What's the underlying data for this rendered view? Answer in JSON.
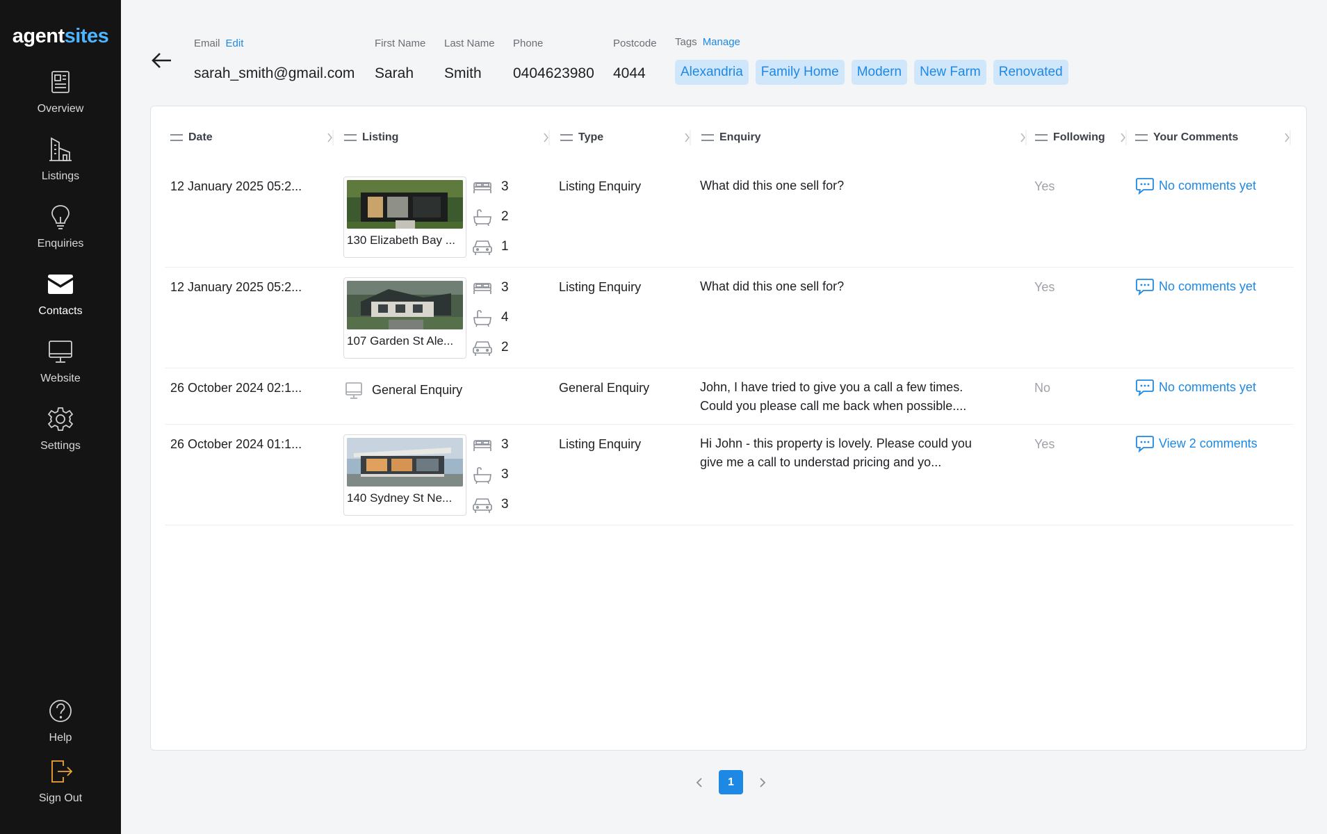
{
  "brand": {
    "part1": "agent",
    "part2": "sites"
  },
  "sidebar": {
    "items": [
      {
        "label": "Overview",
        "icon": "overview-icon"
      },
      {
        "label": "Listings",
        "icon": "listings-icon"
      },
      {
        "label": "Enquiries",
        "icon": "lightbulb-icon"
      },
      {
        "label": "Contacts",
        "icon": "envelope-icon",
        "active": true
      },
      {
        "label": "Website",
        "icon": "monitor-icon"
      },
      {
        "label": "Settings",
        "icon": "gear-icon"
      }
    ],
    "bottom": [
      {
        "label": "Help",
        "icon": "help-icon"
      },
      {
        "label": "Sign Out",
        "icon": "sign-out-icon"
      }
    ]
  },
  "contact": {
    "email_label": "Email",
    "email_edit": "Edit",
    "email": "sarah_smith@gmail.com",
    "first_name_label": "First Name",
    "first_name": "Sarah",
    "last_name_label": "Last Name",
    "last_name": "Smith",
    "phone_label": "Phone",
    "phone": "0404623980",
    "postcode_label": "Postcode",
    "postcode": "4044",
    "tags_label": "Tags",
    "tags_manage": "Manage",
    "tags": [
      "Alexandria",
      "Family Home",
      "Modern",
      "New Farm",
      "Renovated"
    ]
  },
  "table": {
    "headers": [
      "Date",
      "Listing",
      "Type",
      "Enquiry",
      "Following",
      "Your Comments"
    ],
    "rows": [
      {
        "date": "12 January 2025 05:2...",
        "listing_name": "130 Elizabeth Bay ...",
        "beds": "3",
        "baths": "2",
        "cars": "1",
        "type": "Listing Enquiry",
        "enquiry": "What did this one sell for?",
        "following": "Yes",
        "comments": "No comments yet"
      },
      {
        "date": "12 January 2025 05:2...",
        "listing_name": "107 Garden St Ale...",
        "beds": "3",
        "baths": "4",
        "cars": "2",
        "type": "Listing Enquiry",
        "enquiry": "What did this one sell for?",
        "following": "Yes",
        "comments": "No comments yet"
      },
      {
        "date": "26 October 2024 02:1...",
        "listing_name": "General Enquiry",
        "type": "General Enquiry",
        "enquiry": "John, I have tried to give you a call a few times. Could you please call me back when possible....",
        "following": "No",
        "comments": "No comments yet"
      },
      {
        "date": "26 October 2024 01:1...",
        "listing_name": "140 Sydney St Ne...",
        "beds": "3",
        "baths": "3",
        "cars": "3",
        "type": "Listing Enquiry",
        "enquiry": "Hi John - this property is lovely. Please could you give me a call to understad pricing and yo...",
        "following": "Yes",
        "comments": "View 2 comments"
      }
    ]
  },
  "pagination": {
    "current": "1"
  },
  "colors": {
    "accent": "#1e88e5",
    "sidebar_bg": "#141414",
    "tag_bg": "#cfe6fb",
    "signout": "#f2a436"
  }
}
